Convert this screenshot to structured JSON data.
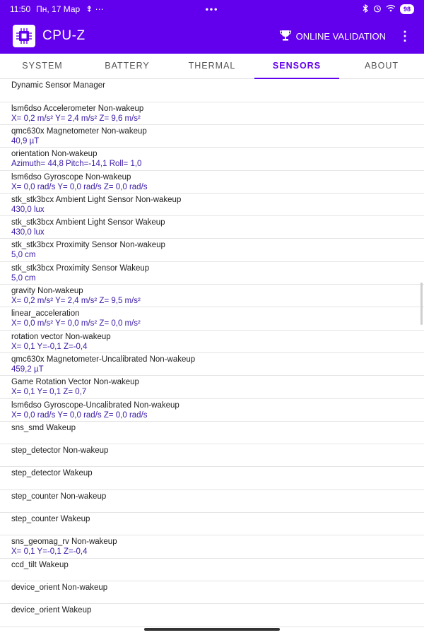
{
  "status": {
    "time": "11:50",
    "date": "Пн, 17 Мар",
    "extra": "⇞ ⋯",
    "center_dots": "•••",
    "battery": "98"
  },
  "appbar": {
    "title": "CPU-Z",
    "validation_label": "ONLINE VALIDATION"
  },
  "tabs": [
    "SYSTEM",
    "BATTERY",
    "THERMAL",
    "SENSORS",
    "ABOUT"
  ],
  "sensors": [
    {
      "name": "Dynamic Sensor Manager",
      "value": ""
    },
    {
      "name": "lsm6dso Accelerometer Non-wakeup",
      "value": "X= 0,2 m/s²   Y= 2,4 m/s²   Z= 9,6 m/s²"
    },
    {
      "name": "qmc630x Magnetometer Non-wakeup",
      "value": "40,9 µT"
    },
    {
      "name": "orientation  Non-wakeup",
      "value": "Azimuth= 44,8   Pitch=-14,1   Roll= 1,0"
    },
    {
      "name": "lsm6dso Gyroscope Non-wakeup",
      "value": "X= 0,0 rad/s   Y= 0,0 rad/s   Z= 0,0 rad/s"
    },
    {
      "name": "stk_stk3bcx Ambient Light Sensor Non-wakeup",
      "value": "430,0 lux"
    },
    {
      "name": "stk_stk3bcx Ambient Light Sensor Wakeup",
      "value": "430,0 lux"
    },
    {
      "name": "stk_stk3bcx Proximity Sensor Non-wakeup",
      "value": "5,0 cm"
    },
    {
      "name": "stk_stk3bcx Proximity Sensor Wakeup",
      "value": "5,0 cm"
    },
    {
      "name": "gravity  Non-wakeup",
      "value": "X= 0,2 m/s²   Y= 2,4 m/s²   Z= 9,5 m/s²"
    },
    {
      "name": "linear_acceleration",
      "value": "X= 0,0 m/s²   Y= 0,0 m/s²   Z= 0,0 m/s²"
    },
    {
      "name": "rotation vector  Non-wakeup",
      "value": "X= 0,1   Y=-0,1   Z=-0,4"
    },
    {
      "name": "qmc630x Magnetometer-Uncalibrated Non-wakeup",
      "value": "459,2 µT"
    },
    {
      "name": "Game Rotation Vector  Non-wakeup",
      "value": "X= 0,1   Y= 0,1   Z= 0,7"
    },
    {
      "name": "lsm6dso Gyroscope-Uncalibrated Non-wakeup",
      "value": "X= 0,0 rad/s   Y= 0,0 rad/s   Z= 0,0 rad/s"
    },
    {
      "name": "sns_smd  Wakeup",
      "value": ""
    },
    {
      "name": "step_detector  Non-wakeup",
      "value": ""
    },
    {
      "name": "step_detector  Wakeup",
      "value": ""
    },
    {
      "name": "step_counter  Non-wakeup",
      "value": ""
    },
    {
      "name": "step_counter  Wakeup",
      "value": ""
    },
    {
      "name": "sns_geomag_rv  Non-wakeup",
      "value": "X= 0,1   Y=-0,1   Z=-0,4"
    },
    {
      "name": "ccd_tilt  Wakeup",
      "value": ""
    },
    {
      "name": "device_orient  Non-wakeup",
      "value": ""
    },
    {
      "name": "device_orient  Wakeup",
      "value": ""
    }
  ],
  "colors": {
    "accent": "#6200ee",
    "value_text": "#3b1aa6"
  }
}
